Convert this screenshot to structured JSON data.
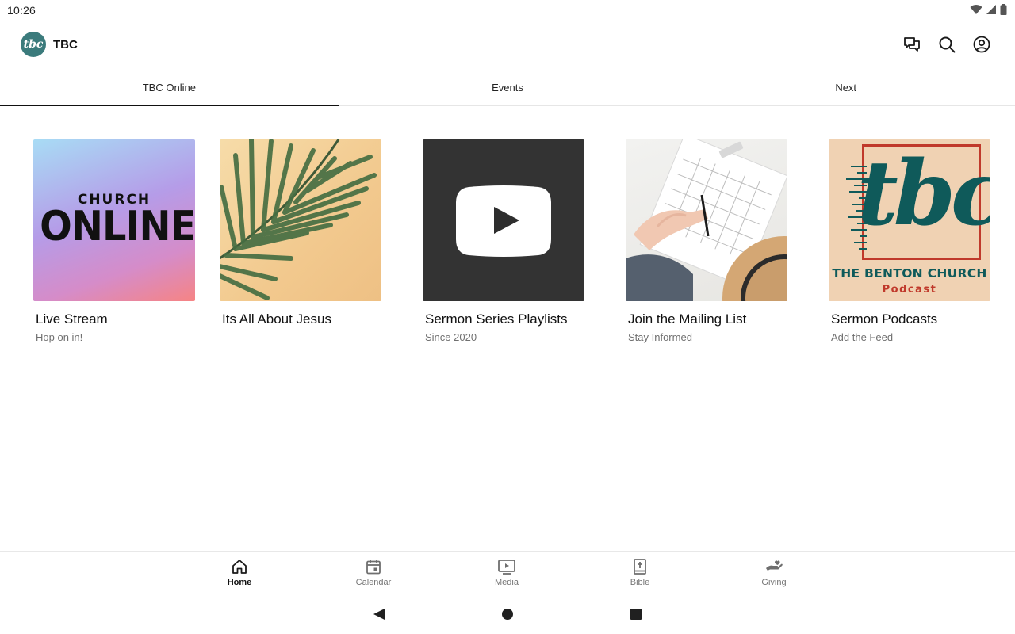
{
  "status": {
    "time": "10:26"
  },
  "app": {
    "title": "TBC",
    "logo_text": "tbc",
    "actions": {
      "chat": "chat-icon",
      "search": "search-icon",
      "account": "account-icon"
    }
  },
  "tabs": [
    {
      "label": "TBC Online",
      "active": true
    },
    {
      "label": "Events",
      "active": false
    },
    {
      "label": "Next",
      "active": false
    }
  ],
  "cards": [
    {
      "title": "Live Stream",
      "subtitle": "Hop on in!",
      "art": {
        "line1": "CHURCH",
        "line2": "ONLINE"
      }
    },
    {
      "title": "Its All About Jesus",
      "subtitle": ""
    },
    {
      "title": "Sermon Series Playlists",
      "subtitle": "Since 2020"
    },
    {
      "title": "Join the Mailing List",
      "subtitle": "Stay Informed"
    },
    {
      "title": "Sermon Podcasts",
      "subtitle": "Add the Feed",
      "art": {
        "logo": "tbc",
        "name": "THE BENTON CHURCH",
        "tag": "Podcast"
      }
    }
  ],
  "bottom_nav": [
    {
      "label": "Home",
      "icon": "home-icon",
      "active": true
    },
    {
      "label": "Calendar",
      "icon": "calendar-icon",
      "active": false
    },
    {
      "label": "Media",
      "icon": "media-icon",
      "active": false
    },
    {
      "label": "Bible",
      "icon": "bible-icon",
      "active": false
    },
    {
      "label": "Giving",
      "icon": "giving-icon",
      "active": false
    }
  ],
  "colors": {
    "brand": "#3b7b7c",
    "podcast_red": "#c0392b",
    "tbc_teal": "#0f5a5a"
  }
}
